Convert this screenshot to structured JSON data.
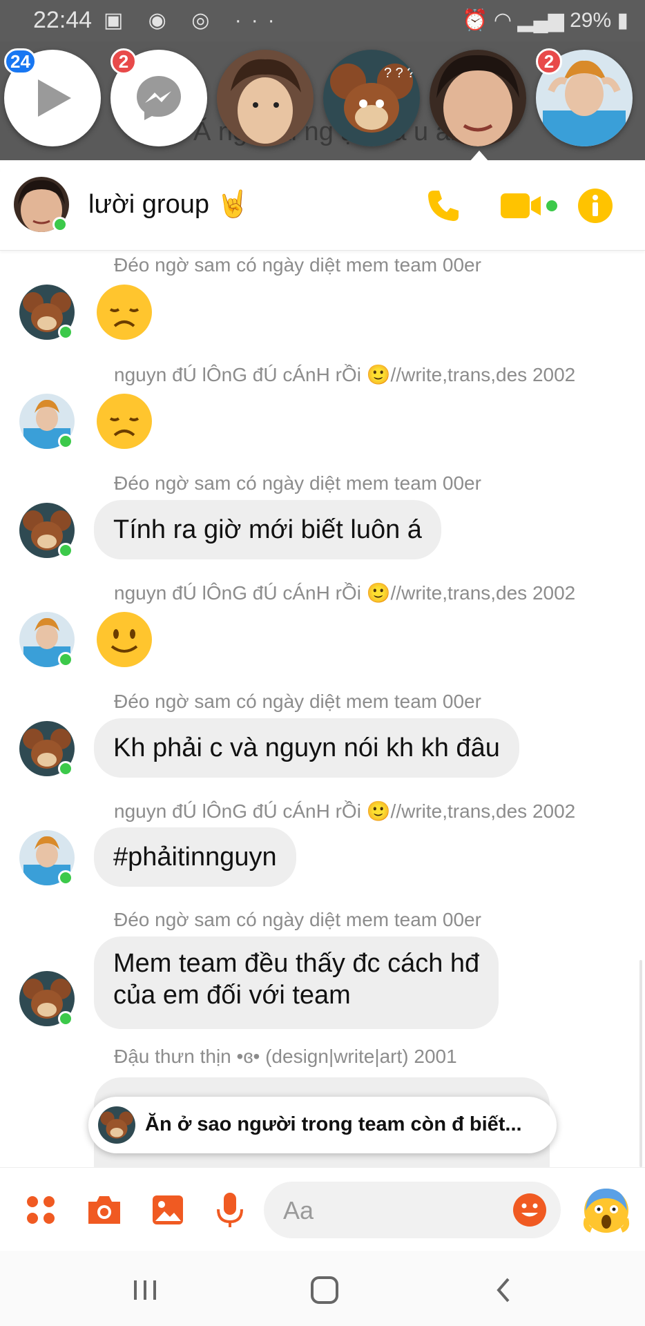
{
  "status_bar": {
    "time": "22:44",
    "left_icons": "▣ ◉ ◎ ···",
    "battery": "29%"
  },
  "background": {
    "text": "Ă ng  đ ai  ng  ạt  ã  a  u  ai."
  },
  "chat_heads": [
    {
      "name": "video-chathead",
      "badge": "24",
      "badge_color": "#1877f2"
    },
    {
      "name": "messenger-chathead",
      "badge": "2",
      "badge_color": "#e84a4a"
    },
    {
      "name": "contact-chathead-1",
      "badge": ""
    },
    {
      "name": "contact-chathead-2",
      "badge": ""
    },
    {
      "name": "contact-chathead-3",
      "badge": ""
    },
    {
      "name": "contact-chathead-4",
      "badge": "2",
      "badge_color": "#e84a4a"
    }
  ],
  "header": {
    "title": "lười group 🤘",
    "icons": [
      "phone-icon",
      "video-camera-icon",
      "info-icon"
    ],
    "accent": "#ffc300"
  },
  "messages": [
    {
      "sender": "Đéo ngờ sam có ngày diệt mem team 00er",
      "content": "😞",
      "type": "emoji"
    },
    {
      "sender": "nguyn đÚ lÔnG đÚ cÁnH rỒi 🙂//write,trans,des 2002",
      "content": "😞",
      "type": "emoji"
    },
    {
      "sender": "Đéo ngờ sam có ngày diệt mem team 00er",
      "content": "Tính ra giờ mới biết luôn á",
      "type": "text"
    },
    {
      "sender": "nguyn đÚ lÔnG đÚ cÁnH rỒi 🙂//write,trans,des 2002",
      "content": "🙂",
      "type": "emoji"
    },
    {
      "sender": "Đéo ngờ sam có ngày diệt mem team 00er",
      "content": "Kh phải c và nguyn nói kh kh đâu",
      "type": "text"
    },
    {
      "sender": "nguyn đÚ lÔnG đÚ cÁnH rỒi 🙂//write,trans,des 2002",
      "content": "#phảitinnguyn",
      "type": "text"
    },
    {
      "sender": "Đéo ngờ sam có ngày diệt mem team 00er",
      "content_lines": [
        "Mem team đều thấy đc cách hđ",
        "của em đối với team"
      ],
      "type": "text"
    },
    {
      "sender": "Đậu thưn thịn •ɞ•  (design|write|art) 2001",
      "content": "",
      "type": "text"
    }
  ],
  "new_message_preview": {
    "text": "Ăn ở sao người trong team còn đ biết..."
  },
  "composer": {
    "placeholder": "Aa",
    "value": "",
    "icons": [
      "more-dots-icon",
      "camera-icon",
      "gallery-icon",
      "microphone-icon",
      "emoji-icon",
      "quick-reaction-icon"
    ],
    "accent": "#f05a22"
  },
  "nav_bar": {
    "icons": [
      "recent-apps-icon",
      "home-icon",
      "back-icon"
    ]
  }
}
